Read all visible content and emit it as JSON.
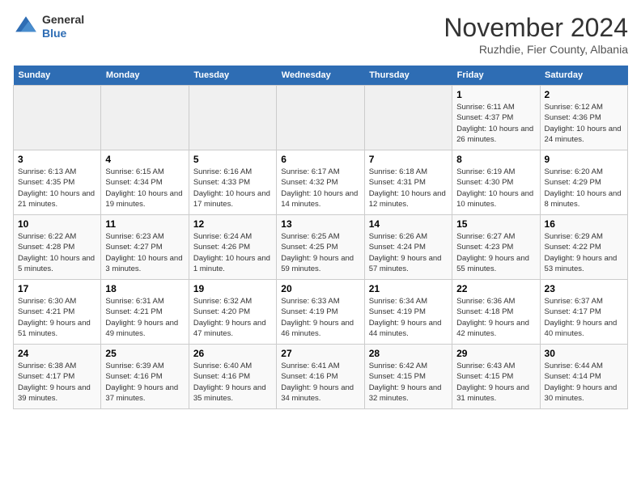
{
  "header": {
    "logo_general": "General",
    "logo_blue": "Blue",
    "month_title": "November 2024",
    "location": "Ruzhdie, Fier County, Albania"
  },
  "days_of_week": [
    "Sunday",
    "Monday",
    "Tuesday",
    "Wednesday",
    "Thursday",
    "Friday",
    "Saturday"
  ],
  "weeks": [
    [
      {
        "day": "",
        "detail": ""
      },
      {
        "day": "",
        "detail": ""
      },
      {
        "day": "",
        "detail": ""
      },
      {
        "day": "",
        "detail": ""
      },
      {
        "day": "",
        "detail": ""
      },
      {
        "day": "1",
        "detail": "Sunrise: 6:11 AM\nSunset: 4:37 PM\nDaylight: 10 hours and 26 minutes."
      },
      {
        "day": "2",
        "detail": "Sunrise: 6:12 AM\nSunset: 4:36 PM\nDaylight: 10 hours and 24 minutes."
      }
    ],
    [
      {
        "day": "3",
        "detail": "Sunrise: 6:13 AM\nSunset: 4:35 PM\nDaylight: 10 hours and 21 minutes."
      },
      {
        "day": "4",
        "detail": "Sunrise: 6:15 AM\nSunset: 4:34 PM\nDaylight: 10 hours and 19 minutes."
      },
      {
        "day": "5",
        "detail": "Sunrise: 6:16 AM\nSunset: 4:33 PM\nDaylight: 10 hours and 17 minutes."
      },
      {
        "day": "6",
        "detail": "Sunrise: 6:17 AM\nSunset: 4:32 PM\nDaylight: 10 hours and 14 minutes."
      },
      {
        "day": "7",
        "detail": "Sunrise: 6:18 AM\nSunset: 4:31 PM\nDaylight: 10 hours and 12 minutes."
      },
      {
        "day": "8",
        "detail": "Sunrise: 6:19 AM\nSunset: 4:30 PM\nDaylight: 10 hours and 10 minutes."
      },
      {
        "day": "9",
        "detail": "Sunrise: 6:20 AM\nSunset: 4:29 PM\nDaylight: 10 hours and 8 minutes."
      }
    ],
    [
      {
        "day": "10",
        "detail": "Sunrise: 6:22 AM\nSunset: 4:28 PM\nDaylight: 10 hours and 5 minutes."
      },
      {
        "day": "11",
        "detail": "Sunrise: 6:23 AM\nSunset: 4:27 PM\nDaylight: 10 hours and 3 minutes."
      },
      {
        "day": "12",
        "detail": "Sunrise: 6:24 AM\nSunset: 4:26 PM\nDaylight: 10 hours and 1 minute."
      },
      {
        "day": "13",
        "detail": "Sunrise: 6:25 AM\nSunset: 4:25 PM\nDaylight: 9 hours and 59 minutes."
      },
      {
        "day": "14",
        "detail": "Sunrise: 6:26 AM\nSunset: 4:24 PM\nDaylight: 9 hours and 57 minutes."
      },
      {
        "day": "15",
        "detail": "Sunrise: 6:27 AM\nSunset: 4:23 PM\nDaylight: 9 hours and 55 minutes."
      },
      {
        "day": "16",
        "detail": "Sunrise: 6:29 AM\nSunset: 4:22 PM\nDaylight: 9 hours and 53 minutes."
      }
    ],
    [
      {
        "day": "17",
        "detail": "Sunrise: 6:30 AM\nSunset: 4:21 PM\nDaylight: 9 hours and 51 minutes."
      },
      {
        "day": "18",
        "detail": "Sunrise: 6:31 AM\nSunset: 4:21 PM\nDaylight: 9 hours and 49 minutes."
      },
      {
        "day": "19",
        "detail": "Sunrise: 6:32 AM\nSunset: 4:20 PM\nDaylight: 9 hours and 47 minutes."
      },
      {
        "day": "20",
        "detail": "Sunrise: 6:33 AM\nSunset: 4:19 PM\nDaylight: 9 hours and 46 minutes."
      },
      {
        "day": "21",
        "detail": "Sunrise: 6:34 AM\nSunset: 4:19 PM\nDaylight: 9 hours and 44 minutes."
      },
      {
        "day": "22",
        "detail": "Sunrise: 6:36 AM\nSunset: 4:18 PM\nDaylight: 9 hours and 42 minutes."
      },
      {
        "day": "23",
        "detail": "Sunrise: 6:37 AM\nSunset: 4:17 PM\nDaylight: 9 hours and 40 minutes."
      }
    ],
    [
      {
        "day": "24",
        "detail": "Sunrise: 6:38 AM\nSunset: 4:17 PM\nDaylight: 9 hours and 39 minutes."
      },
      {
        "day": "25",
        "detail": "Sunrise: 6:39 AM\nSunset: 4:16 PM\nDaylight: 9 hours and 37 minutes."
      },
      {
        "day": "26",
        "detail": "Sunrise: 6:40 AM\nSunset: 4:16 PM\nDaylight: 9 hours and 35 minutes."
      },
      {
        "day": "27",
        "detail": "Sunrise: 6:41 AM\nSunset: 4:16 PM\nDaylight: 9 hours and 34 minutes."
      },
      {
        "day": "28",
        "detail": "Sunrise: 6:42 AM\nSunset: 4:15 PM\nDaylight: 9 hours and 32 minutes."
      },
      {
        "day": "29",
        "detail": "Sunrise: 6:43 AM\nSunset: 4:15 PM\nDaylight: 9 hours and 31 minutes."
      },
      {
        "day": "30",
        "detail": "Sunrise: 6:44 AM\nSunset: 4:14 PM\nDaylight: 9 hours and 30 minutes."
      }
    ]
  ]
}
